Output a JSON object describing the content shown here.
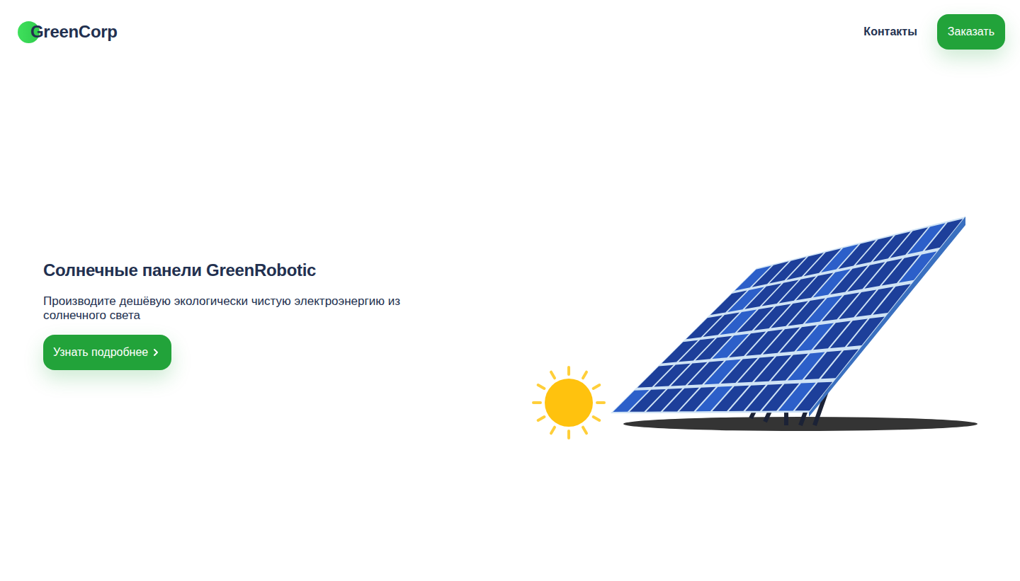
{
  "header": {
    "logo": "GreenCorp",
    "nav": [
      {
        "label": "Контакты"
      }
    ],
    "cta": "Заказать"
  },
  "hero": {
    "title": "Солнечные панели GreenRobotic",
    "subtitle": "Производите дешёвую экологически чистую электроэнергию из солнечного света",
    "button": "Узнать подробнее"
  }
}
